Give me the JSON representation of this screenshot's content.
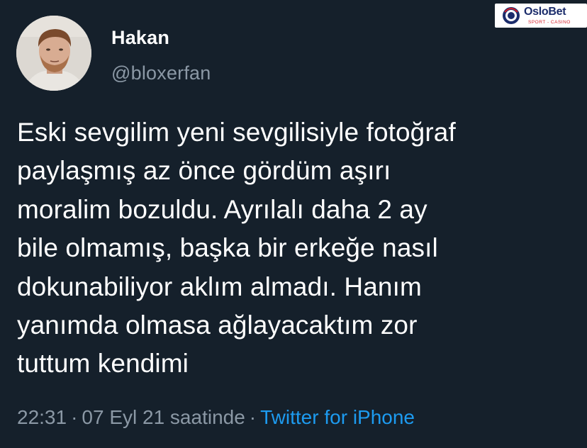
{
  "tweet": {
    "author": {
      "name": "Hakan",
      "handle": "@bloxerfan"
    },
    "body_lines": [
      "Eski sevgilim yeni sevgilisiyle fotoğraf",
      "paylaşmış az önce gördüm aşırı",
      "moralim bozuldu. Ayrılalı daha 2 ay",
      "bile olmamış, başka bir erkeğe nasıl",
      "dokunabiliyor aklım almadı. Hanım",
      "yanımda olmasa ağlayacaktım zor",
      "tuttum kendimi"
    ],
    "meta": {
      "time": "22:31",
      "separator": "·",
      "date": "07 Eyl 21 saatinde",
      "source": "Twitter for iPhone"
    }
  },
  "watermark": {
    "brand": "OsloBet",
    "tagline": "SPORT - CASINO"
  },
  "colors": {
    "background": "#15202b",
    "text": "#ffffff",
    "secondary": "#8b98a5",
    "link": "#1d9bf0"
  }
}
